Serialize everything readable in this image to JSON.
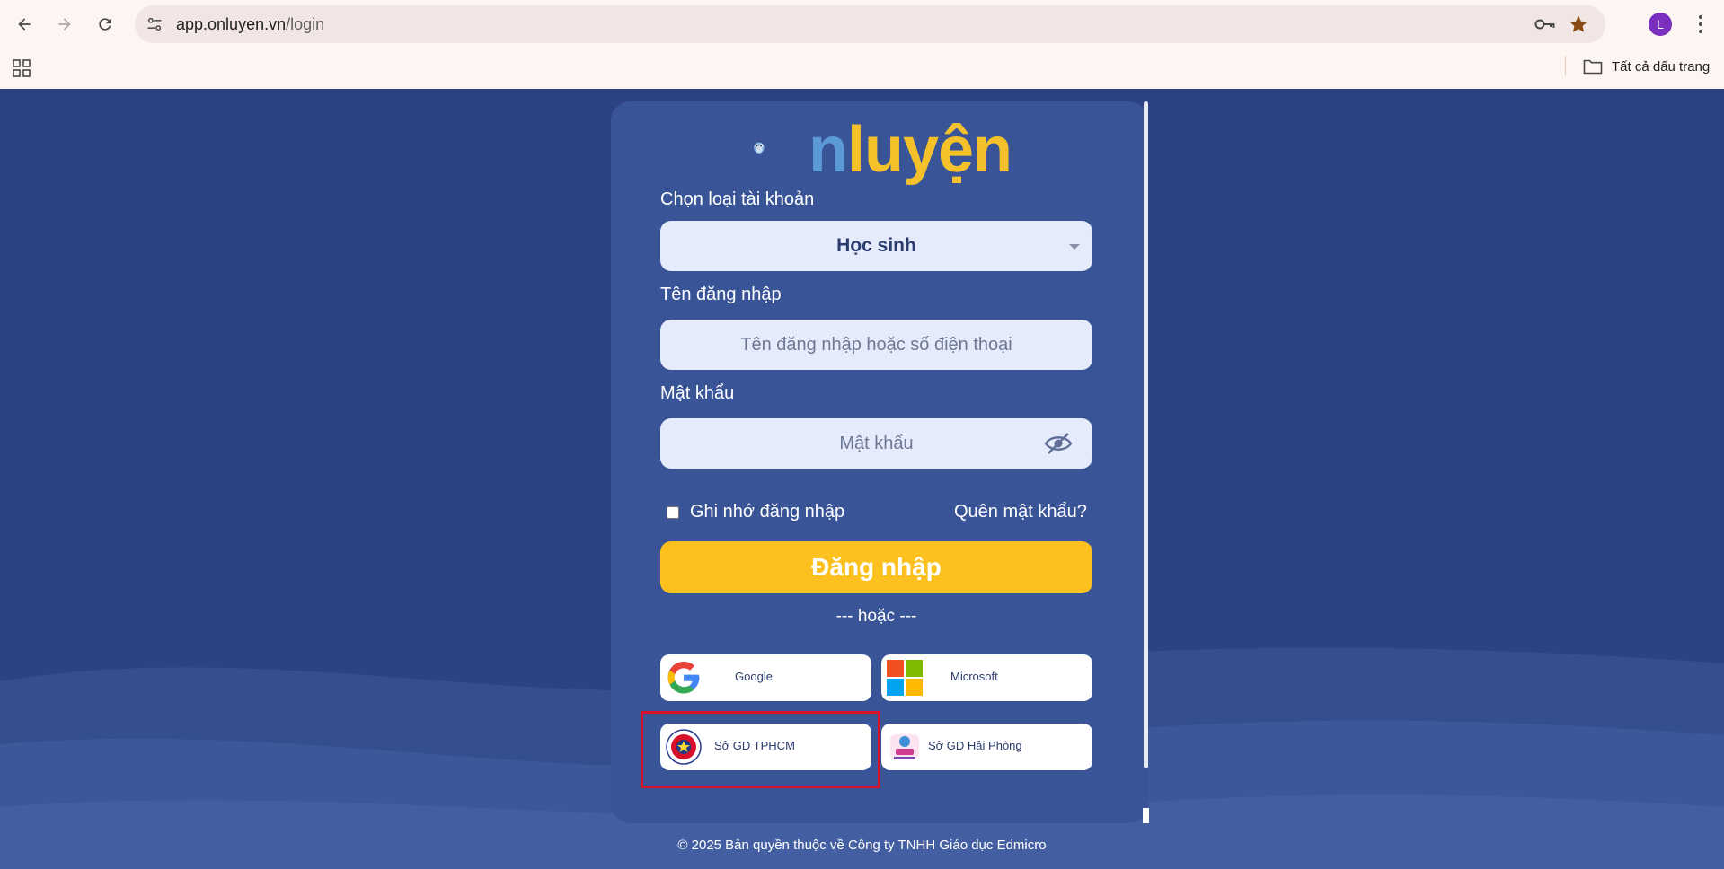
{
  "browser": {
    "url_host": "app.onluyen.vn",
    "url_path": "/login",
    "profile_initial": "L",
    "bookmarks_all_label": "Tất cả dấu trang",
    "icons": {
      "back": "arrow-left-icon",
      "forward": "arrow-right-icon",
      "reload": "reload-icon",
      "site_info": "tune-icon",
      "password": "key-icon",
      "bookmark": "star-icon",
      "menu": "kebab-menu-icon",
      "apps": "apps-grid-icon",
      "folder": "folder-icon"
    },
    "colors": {
      "star": "#8a4a14",
      "avatar": "#7b2fbf"
    }
  },
  "logo": {
    "text_prefix": "n",
    "text_main": "luyện",
    "colors": {
      "main": "#f5c12b",
      "n": "#5b9ad6"
    }
  },
  "form": {
    "account_type_label": "Chọn loại tài khoản",
    "account_type_value": "Học sinh",
    "username_label": "Tên đăng nhập",
    "username_placeholder": "Tên đăng nhập hoặc số điện thoại",
    "password_label": "Mật khẩu",
    "password_placeholder": "Mật khẩu",
    "remember_label": "Ghi nhớ đăng nhập",
    "remember_checked": false,
    "forgot_label": "Quên mật khẩu?",
    "login_button": "Đăng nhập",
    "or_text": "--- hoặc ---",
    "colors": {
      "login_button": "#fdc11f",
      "input_bg": "#e6ebfb",
      "card_bg": "#3a5597"
    }
  },
  "social": [
    {
      "label": "Google",
      "icon": "google-icon"
    },
    {
      "label": "Microsoft",
      "icon": "microsoft-icon"
    },
    {
      "label": "Sở GD TPHCM",
      "icon": "so-gd-tphcm-logo-icon"
    },
    {
      "label": "Sở GD Hải Phòng",
      "icon": "so-gd-hai-phong-logo-icon"
    }
  ],
  "highlight": {
    "target": "Sở GD TPHCM",
    "color": "#d8112a"
  },
  "footer": {
    "copyright": "© 2025 Bản quyền thuộc về Công ty TNHH Giáo dục Edmicro"
  }
}
